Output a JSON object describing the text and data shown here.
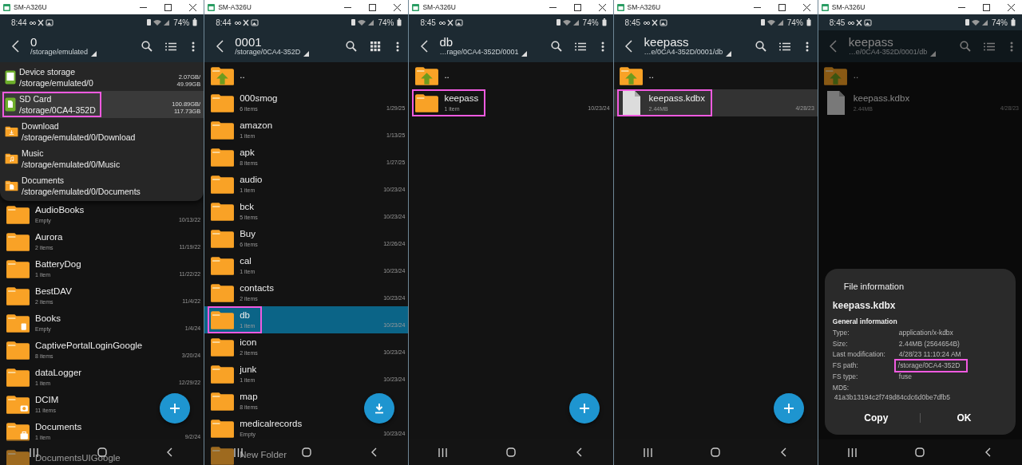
{
  "windows": [
    {
      "title": "SM-A326U",
      "dimmed": false,
      "status": {
        "time": "8:44",
        "battery": "74%"
      },
      "toolbar": {
        "title": "0",
        "path": "/storage/emulated",
        "kind": "list"
      },
      "dropdown": [
        {
          "kind": "storage",
          "name": "Device storage",
          "path": "/storage/emulated/0",
          "used": "2.07GB/",
          "total": "49.99GB",
          "selected": false,
          "highlighted": false
        },
        {
          "kind": "sdcard",
          "name": "SD Card",
          "path": "/storage/0CA4-352D",
          "used": "100.89GB/",
          "total": "117.73GB",
          "selected": true,
          "highlighted": true
        },
        {
          "kind": "download",
          "name": "Download",
          "path": "/storage/emulated/0/Download",
          "selected": false,
          "highlighted": false
        },
        {
          "kind": "music",
          "name": "Music",
          "path": "/storage/emulated/0/Music",
          "selected": false,
          "highlighted": false
        },
        {
          "kind": "documents",
          "name": "Documents",
          "path": "/storage/emulated/0/Documents",
          "selected": false,
          "highlighted": false
        }
      ],
      "rows": [
        {
          "kind": "folder",
          "name": "AudioBooks",
          "info": "Empty",
          "date": "10/13/22",
          "selected": false,
          "highlighted": false
        },
        {
          "kind": "folder",
          "name": "Aurora",
          "info": "2 items",
          "date": "11/19/22",
          "selected": false,
          "highlighted": false
        },
        {
          "kind": "folder",
          "name": "BatteryDog",
          "info": "1 item",
          "date": "11/22/22",
          "selected": false,
          "highlighted": false
        },
        {
          "kind": "folder",
          "name": "BestDAV",
          "info": "2 items",
          "date": "11/4/22",
          "selected": false,
          "highlighted": false
        },
        {
          "kind": "books",
          "name": "Books",
          "info": "Empty",
          "date": "1/4/24",
          "selected": false,
          "highlighted": false
        },
        {
          "kind": "folder",
          "name": "CaptivePortalLoginGoogle",
          "info": "8 items",
          "date": "3/20/24",
          "selected": false,
          "highlighted": false
        },
        {
          "kind": "folder",
          "name": "dataLogger",
          "info": "1 item",
          "date": "12/29/22",
          "selected": false,
          "highlighted": false
        },
        {
          "kind": "camera",
          "name": "DCIM",
          "info": "11 items",
          "selected": false,
          "highlighted": false
        },
        {
          "kind": "briefcase",
          "name": "Documents",
          "info": "1 item",
          "date": "9/2/24",
          "selected": false,
          "highlighted": false
        },
        {
          "kind": "folder",
          "name": "DocumentsUIGoogle",
          "selected": false,
          "highlighted": false
        }
      ],
      "fab": {
        "kind": "add"
      }
    },
    {
      "title": "SM-A326U",
      "dimmed": false,
      "status": {
        "time": "8:44",
        "battery": "74%"
      },
      "toolbar": {
        "title": "0001",
        "path": "/storage/0CA4-352D",
        "kind": "grid"
      },
      "rows": [
        {
          "kind": "up",
          "name": "..",
          "selected": false,
          "highlighted": false
        },
        {
          "kind": "folder",
          "name": "000smog",
          "info": "6 items",
          "date": "1/29/25",
          "selected": false,
          "highlighted": false
        },
        {
          "kind": "folder",
          "name": "amazon",
          "info": "1 item",
          "date": "1/13/25",
          "selected": false,
          "highlighted": false
        },
        {
          "kind": "folder",
          "name": "apk",
          "info": "8 items",
          "date": "1/27/25",
          "selected": false,
          "highlighted": false
        },
        {
          "kind": "folder",
          "name": "audio",
          "info": "1 item",
          "date": "10/23/24",
          "selected": false,
          "highlighted": false
        },
        {
          "kind": "folder",
          "name": "bck",
          "info": "5 items",
          "date": "10/23/24",
          "selected": false,
          "highlighted": false
        },
        {
          "kind": "folder",
          "name": "Buy",
          "info": "6 items",
          "date": "12/26/24",
          "selected": false,
          "highlighted": false
        },
        {
          "kind": "folder",
          "name": "cal",
          "info": "1 item",
          "date": "10/23/24",
          "selected": false,
          "highlighted": false
        },
        {
          "kind": "folder",
          "name": "contacts",
          "info": "2 items",
          "date": "10/23/24",
          "selected": false,
          "highlighted": false
        },
        {
          "kind": "folder",
          "name": "db",
          "info": "1 item",
          "date": "10/23/24",
          "selected": true,
          "highlighted": true
        },
        {
          "kind": "folder",
          "name": "icon",
          "info": "2 items",
          "date": "10/23/24",
          "selected": false,
          "highlighted": false
        },
        {
          "kind": "folder",
          "name": "junk",
          "info": "1 item",
          "date": "10/23/24",
          "selected": false,
          "highlighted": false
        },
        {
          "kind": "folder",
          "name": "map",
          "info": "8 items",
          "selected": false,
          "highlighted": false
        },
        {
          "kind": "folder",
          "name": "medicalrecords",
          "info": "Empty",
          "date": "10/23/24",
          "selected": false,
          "highlighted": false
        },
        {
          "kind": "folder",
          "name": "New Folder",
          "selected": false,
          "highlighted": false
        }
      ],
      "fab": {
        "kind": "download"
      }
    },
    {
      "title": "SM-A326U",
      "dimmed": false,
      "status": {
        "time": "8:45",
        "battery": "74%"
      },
      "toolbar": {
        "title": "db",
        "path": "…rage/0CA4-352D/0001",
        "kind": "list"
      },
      "rows": [
        {
          "kind": "up",
          "name": "..",
          "selected": false,
          "highlighted": false
        },
        {
          "kind": "folder",
          "name": "keepass",
          "info": "1 item",
          "date": "10/23/24",
          "selected": false,
          "highlighted": true
        }
      ],
      "fab": {
        "kind": "add"
      }
    },
    {
      "title": "SM-A326U",
      "dimmed": false,
      "status": {
        "time": "8:45",
        "battery": "74%"
      },
      "toolbar": {
        "title": "keepass",
        "path": "…e/0CA4-352D/0001/db",
        "kind": "list"
      },
      "rows": [
        {
          "kind": "up",
          "name": "..",
          "selected": false,
          "highlighted": false
        },
        {
          "kind": "file",
          "name": "keepass.kdbx",
          "info": "2.44MB",
          "date": "4/28/23",
          "selected": true,
          "highlighted": true
        }
      ],
      "fab": {
        "kind": "add"
      }
    },
    {
      "title": "SM-A326U",
      "dimmed": true,
      "status": {
        "time": "8:45",
        "battery": "74%"
      },
      "toolbar": {
        "title": "keepass",
        "path": "…e/0CA4-352D/0001/db",
        "kind": "list"
      },
      "rows": [
        {
          "kind": "up",
          "name": "..",
          "selected": false,
          "highlighted": false
        },
        {
          "kind": "file",
          "name": "keepass.kdbx",
          "info": "2.44MB",
          "date": "4/28/23",
          "selected": false,
          "highlighted": false
        }
      ],
      "dialog": {
        "title": "File information",
        "file_name": "keepass.kdbx",
        "section": "General information",
        "fields": [
          {
            "label": "Type:",
            "value": "application/x-kdbx",
            "highlighted": false
          },
          {
            "label": "Size:",
            "value": "2.44MB (2564654B)",
            "highlighted": false
          },
          {
            "label": "Last modification:",
            "value": "4/28/23 11:10:24 AM",
            "highlighted": false
          },
          {
            "label": "FS path:",
            "value": "/storage/0CA4-352D",
            "highlighted": true
          },
          {
            "label": "FS type:",
            "value": "fuse",
            "highlighted": false
          }
        ],
        "md5_label": "MD5:",
        "md5": "41a3b13194c2f749d84cdc6d0be7dfb5",
        "buttons": [
          "Copy",
          "OK"
        ]
      }
    }
  ]
}
